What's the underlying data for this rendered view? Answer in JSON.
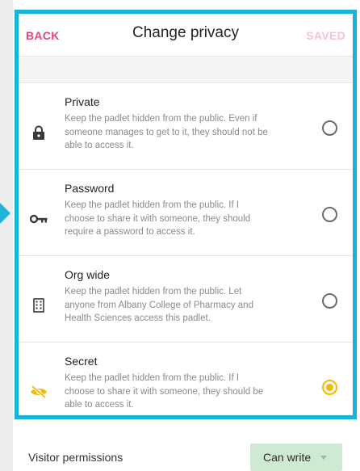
{
  "header": {
    "back_label": "BACK",
    "title": "Change privacy",
    "saved_label": "SAVED"
  },
  "options": [
    {
      "title": "Private",
      "description": "Keep the padlet hidden from the public. Even if someone manages to get to it, they should not be able to access it.",
      "icon": "lock-icon",
      "selected": false
    },
    {
      "title": "Password",
      "description": "Keep the padlet hidden from the public. If I choose to share it with someone, they should require a password to access it.",
      "icon": "key-icon",
      "selected": false
    },
    {
      "title": "Org wide",
      "description": "Keep the padlet hidden from the public. Let anyone from Albany College of Pharmacy and Health Sciences access this padlet.",
      "icon": "building-icon",
      "selected": false
    },
    {
      "title": "Secret",
      "description": "Keep the padlet hidden from the public. If I choose to share it with someone, they should be able to access it.",
      "icon": "eye-off-icon",
      "selected": true
    }
  ],
  "footer": {
    "label": "Visitor permissions",
    "permission_value": "Can write"
  },
  "colors": {
    "accent_pink": "#e2457c",
    "highlight_border": "#18b3d8",
    "selected_radio": "#f5b800",
    "permission_button": "#cfead2"
  }
}
